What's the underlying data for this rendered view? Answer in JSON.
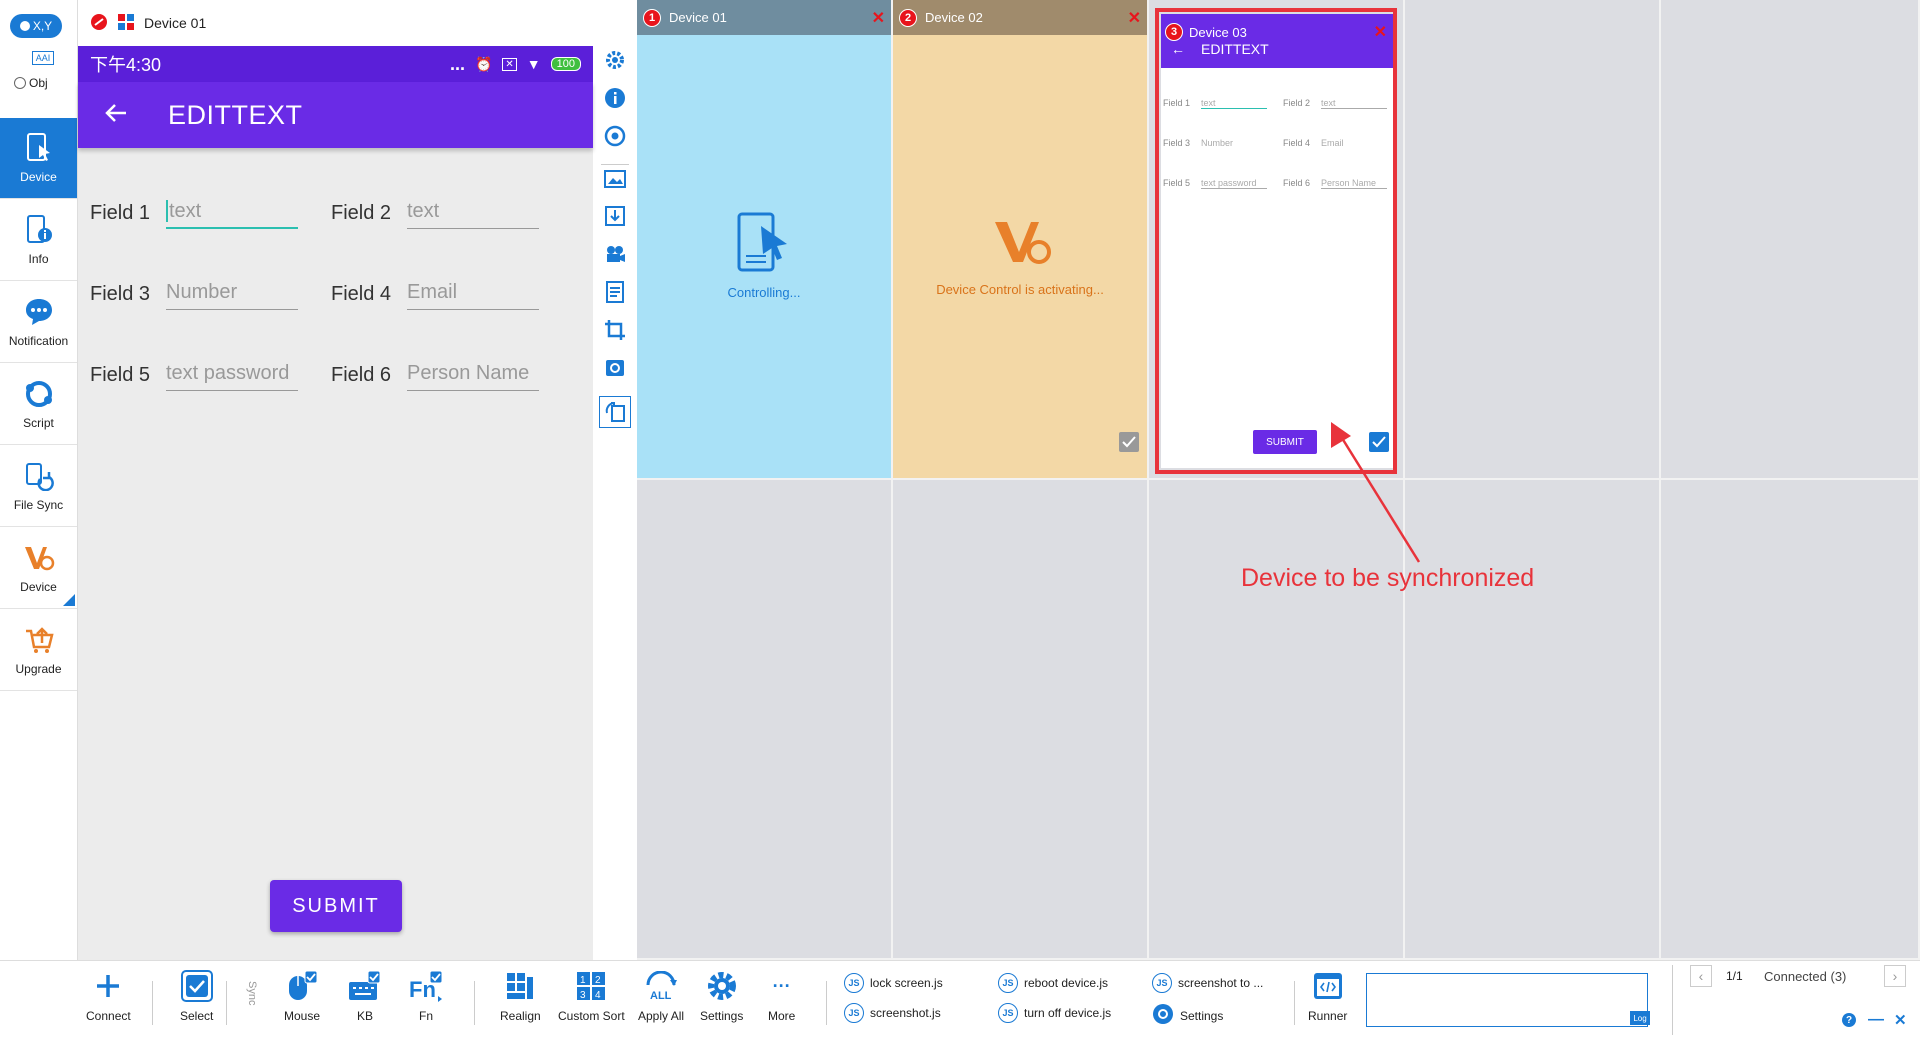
{
  "sidebar": {
    "mode_label": "X,Y",
    "aai_label": "AAI",
    "obj_label": "Obj",
    "items": [
      {
        "label": "Device",
        "icon": "device-cursor-icon",
        "active": true
      },
      {
        "label": "Info",
        "icon": "device-info-icon"
      },
      {
        "label": "Notification",
        "icon": "chat-bubble-icon"
      },
      {
        "label": "Script",
        "icon": "script-icon"
      },
      {
        "label": "File Sync",
        "icon": "file-sync-icon"
      },
      {
        "label": "Device",
        "icon": "vc-logo-icon"
      },
      {
        "label": "Upgrade",
        "icon": "cart-upgrade-icon"
      }
    ]
  },
  "titlebar": {
    "title": "Device 01"
  },
  "phone": {
    "time": "下午4:30",
    "battery": "100",
    "status_dots": "...",
    "app_title": "EDITTEXT",
    "fields": [
      {
        "label": "Field 1",
        "placeholder": "text"
      },
      {
        "label": "Field 2",
        "placeholder": "text"
      },
      {
        "label": "Field 3",
        "placeholder": "Number"
      },
      {
        "label": "Field 4",
        "placeholder": "Email"
      },
      {
        "label": "Field 5",
        "placeholder": "text password"
      },
      {
        "label": "Field 6",
        "placeholder": "Person Name"
      }
    ],
    "submit_label": "SUBMIT"
  },
  "devices": [
    {
      "num": "1",
      "name": "Device 01",
      "status": "Controlling...",
      "header_color": "#6f8d9f",
      "bg": "#a9e1f7"
    },
    {
      "num": "2",
      "name": "Device 02",
      "status": "Device Control is activating...",
      "header_color": "#a08b6c",
      "bg": "#f3d8a6"
    },
    {
      "num": "3",
      "name": "Device 03",
      "mini_title": "EDITTEXT",
      "mini_submit": "SUBMIT",
      "mini_fields": [
        "Field 1",
        "Field 2",
        "Field 3",
        "Field 4",
        "Field 5",
        "Field 6"
      ],
      "mini_placeholders": [
        "text",
        "text",
        "Number",
        "Email",
        "text password",
        "Person Name"
      ]
    }
  ],
  "annotation": {
    "text": "Device to be synchronized",
    "color": "#e8333b"
  },
  "toolbar": {
    "connect": "Connect",
    "select": "Select",
    "sync": "Sync",
    "mouse": "Mouse",
    "kb": "KB",
    "fn": "Fn",
    "realign": "Realign",
    "custom_sort": "Custom Sort",
    "apply_all": "Apply All",
    "settings": "Settings",
    "more": "More",
    "scripts": [
      "lock screen.js",
      "screenshot.js",
      "reboot device.js",
      "turn off device.js",
      "screenshot to ...",
      "Settings"
    ],
    "runner": "Runner",
    "log": "Log",
    "page": "1/1",
    "connected": "Connected (3)"
  },
  "colors": {
    "accent": "#1a7ad4",
    "purple": "#6a2be6",
    "red": "#e8141c"
  }
}
